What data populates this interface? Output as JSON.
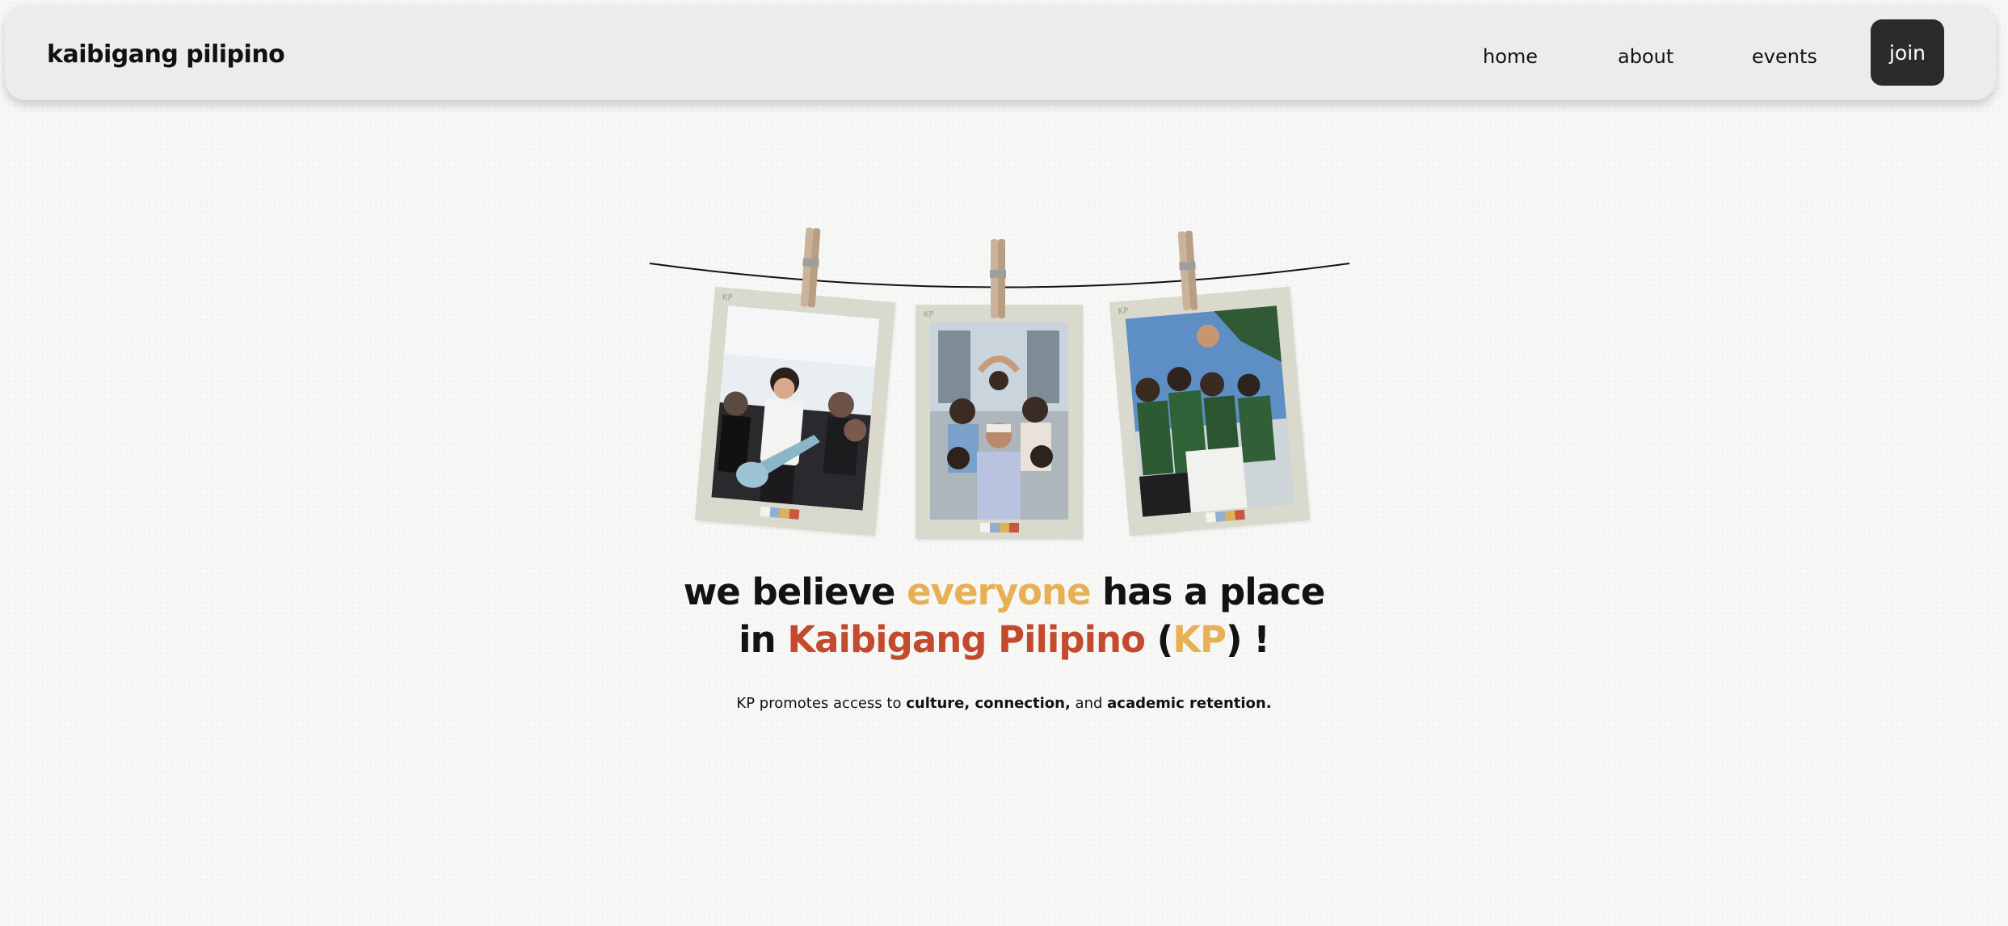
{
  "navbar": {
    "brand": "kaibigang pilipino",
    "links": {
      "home": "home",
      "about": "about",
      "events": "events"
    },
    "join_label": "join"
  },
  "polaroids": [
    {
      "mark": "KP",
      "photo": "performer-with-guitar-photo"
    },
    {
      "mark": "KP",
      "photo": "group-heart-hands-photo"
    },
    {
      "mark": "KP",
      "photo": "crowd-cheering-photo"
    }
  ],
  "hero": {
    "line1_a": "we believe ",
    "line1_b": "everyone",
    "line1_c": " has a place",
    "line2_a": "in ",
    "line2_b": "Kaibigang Pilipino",
    "line2_c": " (",
    "line2_d": "KP",
    "line2_e": ") !",
    "sub_a": "KP promotes access to ",
    "sub_b": "culture, connection,",
    "sub_c": " and ",
    "sub_d": "academic retention."
  },
  "colors": {
    "accent_yellow": "#e8b055",
    "accent_red": "#c34a2c",
    "join_bg": "#2b2b2b",
    "swatches": [
      "#f2f2ee",
      "#8fb0cc",
      "#d9b25a",
      "#c7573f"
    ]
  }
}
